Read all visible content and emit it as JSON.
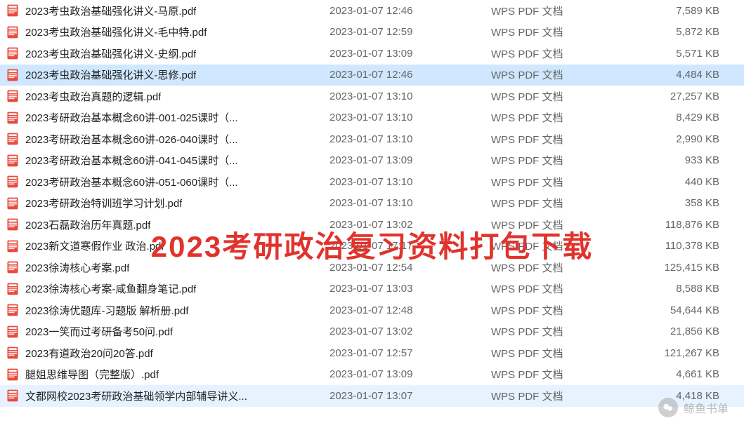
{
  "overlay": "2023考研政治复习资料打包下载",
  "watermark": "鲸鱼书单",
  "files": [
    {
      "name": "2023考虫政治基础强化讲义-马原.pdf",
      "date": "2023-01-07 12:46",
      "type": "WPS PDF 文档",
      "size": "7,589 KB",
      "state": ""
    },
    {
      "name": "2023考虫政治基础强化讲义-毛中特.pdf",
      "date": "2023-01-07 12:59",
      "type": "WPS PDF 文档",
      "size": "5,872 KB",
      "state": ""
    },
    {
      "name": "2023考虫政治基础强化讲义-史纲.pdf",
      "date": "2023-01-07 13:09",
      "type": "WPS PDF 文档",
      "size": "5,571 KB",
      "state": ""
    },
    {
      "name": "2023考虫政治基础强化讲义-思修.pdf",
      "date": "2023-01-07 12:46",
      "type": "WPS PDF 文档",
      "size": "4,484 KB",
      "state": "selected"
    },
    {
      "name": "2023考虫政治真题的逻辑.pdf",
      "date": "2023-01-07 13:10",
      "type": "WPS PDF 文档",
      "size": "27,257 KB",
      "state": ""
    },
    {
      "name": "2023考研政治基本概念60讲-001-025课时（...",
      "date": "2023-01-07 13:10",
      "type": "WPS PDF 文档",
      "size": "8,429 KB",
      "state": ""
    },
    {
      "name": "2023考研政治基本概念60讲-026-040课时（...",
      "date": "2023-01-07 13:10",
      "type": "WPS PDF 文档",
      "size": "2,990 KB",
      "state": ""
    },
    {
      "name": "2023考研政治基本概念60讲-041-045课时（...",
      "date": "2023-01-07 13:09",
      "type": "WPS PDF 文档",
      "size": "933 KB",
      "state": ""
    },
    {
      "name": "2023考研政治基本概念60讲-051-060课时（...",
      "date": "2023-01-07 13:10",
      "type": "WPS PDF 文档",
      "size": "440 KB",
      "state": ""
    },
    {
      "name": "2023考研政治特训班学习计划.pdf",
      "date": "2023-01-07 13:10",
      "type": "WPS PDF 文档",
      "size": "358 KB",
      "state": ""
    },
    {
      "name": "2023石磊政治历年真题.pdf",
      "date": "2023-01-07 13:02",
      "type": "WPS PDF 文档",
      "size": "118,876 KB",
      "state": ""
    },
    {
      "name": "2023新文道寒假作业 政治.pdf",
      "date": "2023-01-07 17:17",
      "type": "WPS PDF 文档",
      "size": "110,378 KB",
      "state": ""
    },
    {
      "name": "2023徐涛核心考案.pdf",
      "date": "2023-01-07 12:54",
      "type": "WPS PDF 文档",
      "size": "125,415 KB",
      "state": ""
    },
    {
      "name": "2023徐涛核心考案-咸鱼翻身笔记.pdf",
      "date": "2023-01-07 13:03",
      "type": "WPS PDF 文档",
      "size": "8,588 KB",
      "state": ""
    },
    {
      "name": "2023徐涛优题库-习题版 解析册.pdf",
      "date": "2023-01-07 12:48",
      "type": "WPS PDF 文档",
      "size": "54,644 KB",
      "state": ""
    },
    {
      "name": "2023一笑而过考研备考50问.pdf",
      "date": "2023-01-07 13:02",
      "type": "WPS PDF 文档",
      "size": "21,856 KB",
      "state": ""
    },
    {
      "name": "2023有道政治20问20答.pdf",
      "date": "2023-01-07 12:57",
      "type": "WPS PDF 文档",
      "size": "121,267 KB",
      "state": ""
    },
    {
      "name": "腿姐思维导图（完整版）.pdf",
      "date": "2023-01-07 13:09",
      "type": "WPS PDF 文档",
      "size": "4,661 KB",
      "state": ""
    },
    {
      "name": "文都网校2023考研政治基础领学内部辅导讲义...",
      "date": "2023-01-07 13:07",
      "type": "WPS PDF 文档",
      "size": "4,418 KB",
      "state": "hover"
    }
  ]
}
